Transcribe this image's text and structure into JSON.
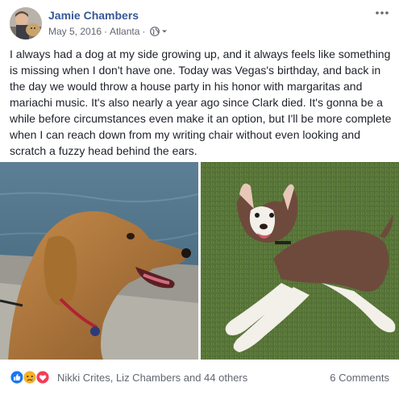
{
  "post": {
    "author": "Jamie Chambers",
    "date": "May 5, 2016",
    "separator": "·",
    "location": "Atlanta",
    "privacy_icon": "globe-icon",
    "more_icon": "more-horizontal-icon",
    "text": "I always had a dog at my side growing up, and it always feels like something is missing when I don't have one. Today was Vegas's birthday, and back in the day we would throw a house party in his honor with margaritas and mariachi music. It's also nearly a year ago since Clark died. It's gonna be a while before circumstances even make it an option, but I'll be more complete when I can reach down from my writing chair without even looking and scratch a fuzzy head behind the ears."
  },
  "photos": [
    {
      "subject": "golden retriever photo",
      "icon": "photo-dog-golden"
    },
    {
      "subject": "husky mix lying on grass photo",
      "icon": "photo-dog-husky"
    }
  ],
  "footer": {
    "reaction_icons": [
      "like-icon",
      "sad-icon",
      "love-icon"
    ],
    "reactors": "Nikki Crites, Liz Chambers and 44 others",
    "comments": "6 Comments"
  },
  "colors": {
    "link": "#385898",
    "meta": "#616770",
    "like": "#1877f2",
    "love": "#f33e58",
    "sad": "#f7b125"
  }
}
